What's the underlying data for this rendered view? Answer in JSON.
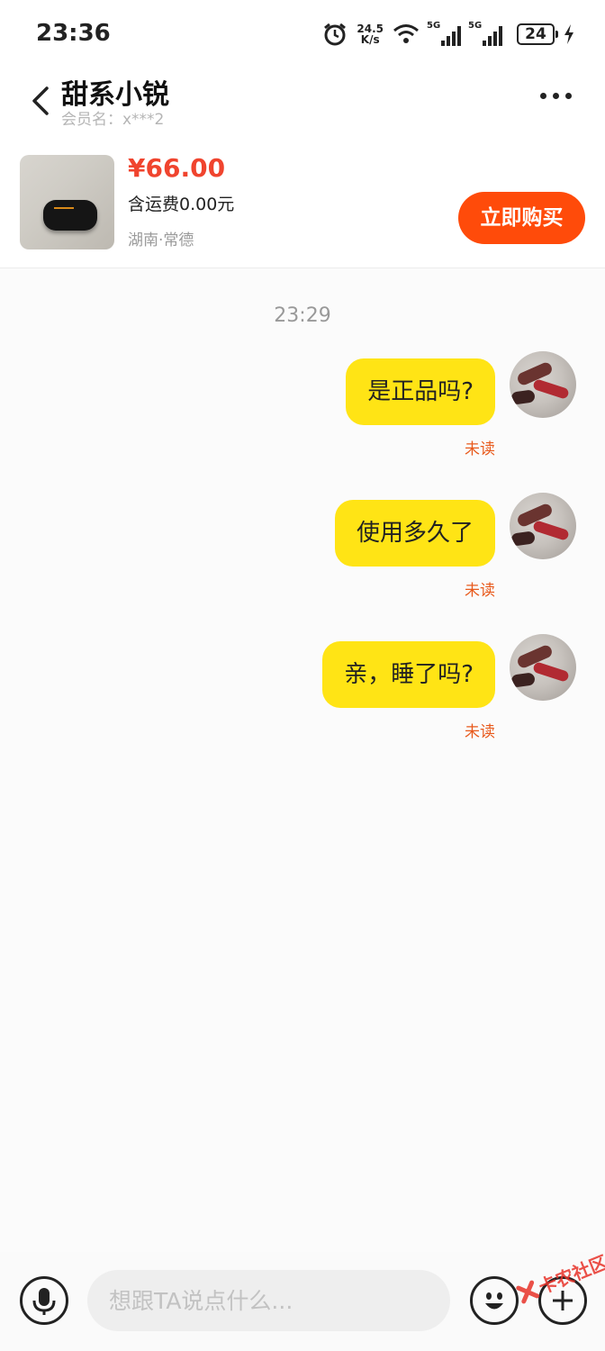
{
  "status_bar": {
    "time": "23:36",
    "net_speed_value": "24.5",
    "net_speed_unit": "K/s",
    "signal_1_tag": "5G",
    "signal_2_tag": "5G",
    "battery": "24",
    "icons": [
      "alarm-icon",
      "wifi-icon",
      "signal-icon",
      "signal-icon",
      "battery-icon",
      "charging-bolt-icon"
    ]
  },
  "header": {
    "title": "甜系小锐",
    "member_name": "会员名：x***2",
    "icons": [
      "back-arrow-icon",
      "more-dots-icon"
    ]
  },
  "product": {
    "price": "¥66.00",
    "shipping": "含运费0.00元",
    "location": "湖南·常德",
    "buy_label": "立即购买",
    "accent_color": "#ff4b0a",
    "price_color": "#f0442e"
  },
  "chat": {
    "timestamp": "23:29",
    "bubble_color": "#ffe415",
    "messages": [
      {
        "text": "是正品吗?",
        "status": "未读"
      },
      {
        "text": "使用多久了",
        "status": "未读"
      },
      {
        "text": "亲，睡了吗?",
        "status": "未读"
      }
    ]
  },
  "input_bar": {
    "placeholder": "想跟TA说点什么...",
    "value": "",
    "icons": [
      "microphone-icon",
      "emoji-icon",
      "plus-icon"
    ]
  },
  "watermark": {
    "text": "卡农社区"
  }
}
